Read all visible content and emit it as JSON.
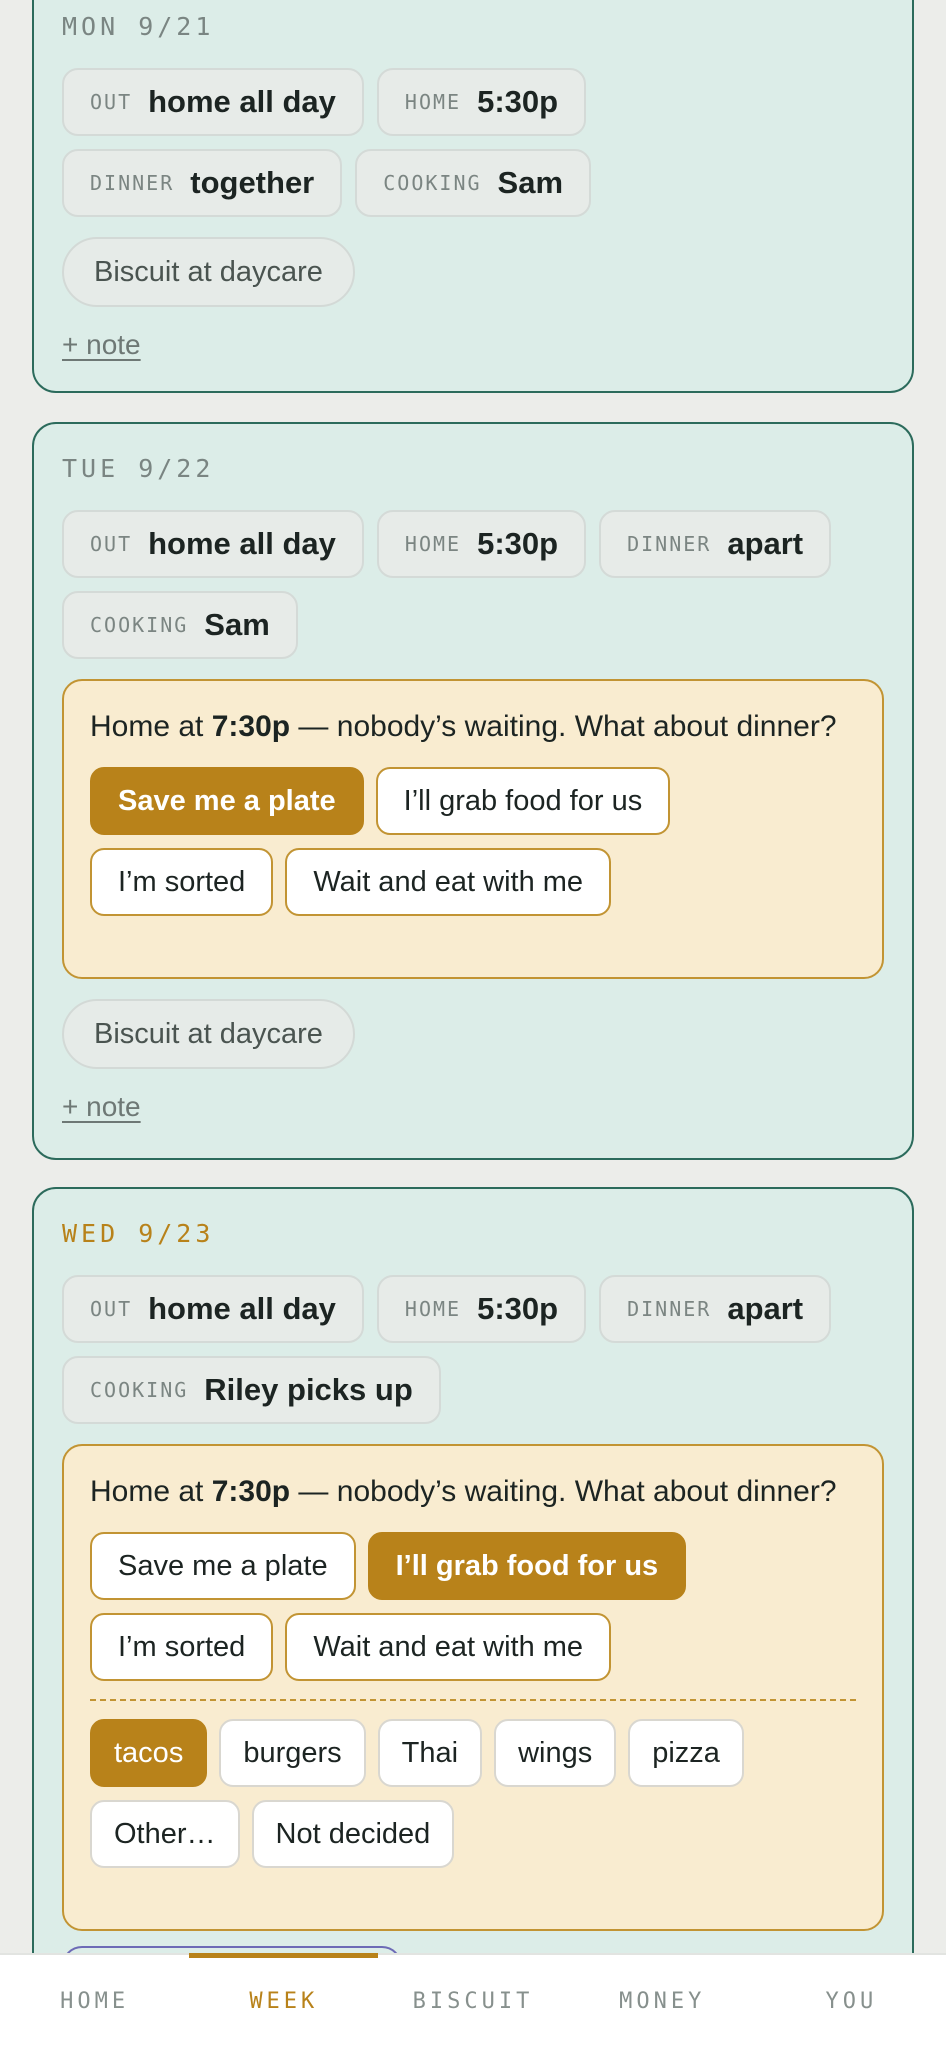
{
  "days": [
    {
      "label": "MON 9/21",
      "chips": [
        {
          "k": "OUT",
          "v": "home all day"
        },
        {
          "k": "HOME",
          "v": "5:30p"
        },
        {
          "k": "DINNER",
          "v": "together"
        },
        {
          "k": "COOKING",
          "v": "Sam"
        }
      ],
      "pill": "Biscuit at daycare",
      "note": "+ note"
    },
    {
      "label": "TUE 9/22",
      "chips": [
        {
          "k": "OUT",
          "v": "home all day"
        },
        {
          "k": "HOME",
          "v": "5:30p"
        },
        {
          "k": "DINNER",
          "v": "apart"
        },
        {
          "k": "COOKING",
          "v": "Sam"
        }
      ],
      "prompt": {
        "pre": "Home at ",
        "time": "7:30p",
        "post": " — nobody’s waiting. What about dinner?",
        "options": [
          "Save me a plate",
          "I’ll grab food for us",
          "I’m sorted",
          "Wait and eat with me"
        ],
        "selected": "Save me a plate"
      },
      "pill": "Biscuit at daycare",
      "note": "+ note"
    },
    {
      "label": "WED 9/23",
      "chips": [
        {
          "k": "OUT",
          "v": "home all day"
        },
        {
          "k": "HOME",
          "v": "5:30p"
        },
        {
          "k": "DINNER",
          "v": "apart"
        },
        {
          "k": "COOKING",
          "v": "Riley picks up"
        }
      ],
      "prompt": {
        "pre": "Home at ",
        "time": "7:30p",
        "post": " — nobody’s waiting. What about dinner?",
        "options": [
          "Save me a plate",
          "I’ll grab food for us",
          "I’m sorted",
          "Wait and eat with me"
        ],
        "selected": "I’ll grab food for us",
        "foods": [
          "tacos",
          "burgers",
          "Thai",
          "wings",
          "pizza",
          "Other…",
          "Not decided"
        ],
        "food_selected": "tacos"
      }
    }
  ],
  "tabs": [
    "HOME",
    "WEEK",
    "BISCUIT",
    "MONEY",
    "YOU"
  ],
  "active_tab": "WEEK",
  "colors": {
    "accent": "#b8821a",
    "card_border": "#2c6b5c",
    "card_bg": "#dcede8",
    "prompt_bg": "#f9ecd0"
  }
}
